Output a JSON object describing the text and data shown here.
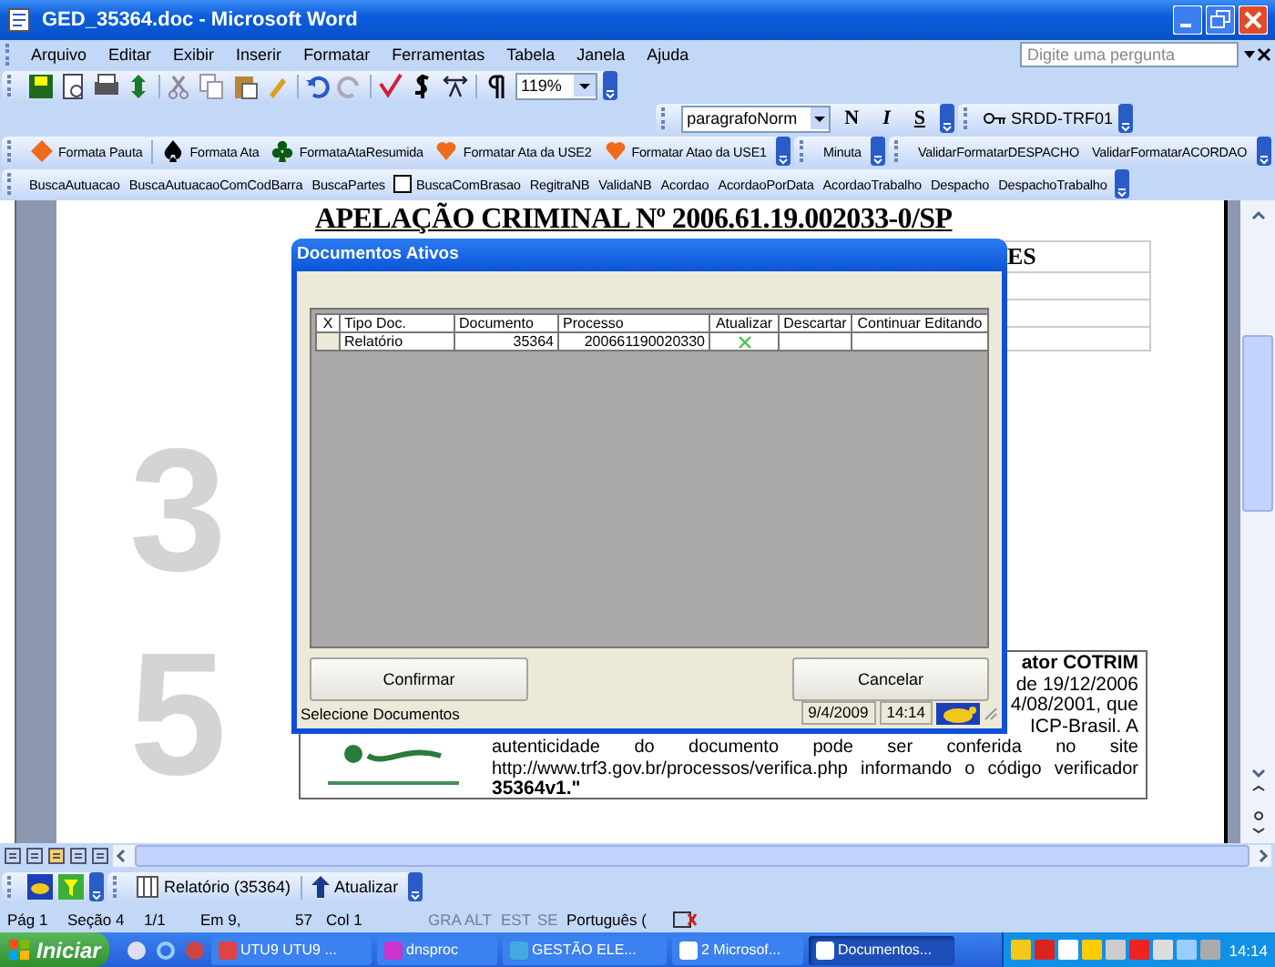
{
  "window": {
    "title": "GED_35364.doc - Microsoft Word"
  },
  "menu": [
    "Arquivo",
    "Editar",
    "Exibir",
    "Inserir",
    "Formatar",
    "Ferramentas",
    "Tabela",
    "Janela",
    "Ajuda"
  ],
  "help_box": {
    "placeholder": "Digite uma pergunta"
  },
  "standard_toolbar": {
    "zoom": "119%"
  },
  "format_toolbar": {
    "style": "paragrafoNorm",
    "buttons": [
      "N",
      "I",
      "S"
    ]
  },
  "srdd_toolbar": {
    "label": "SRDD-TRF01"
  },
  "macro_toolbar": {
    "groups": [
      [
        "Formata Pauta",
        "Formata Ata",
        "FormataAtaResumida",
        "Formatar Ata da USE2",
        "Formatar Atao da USE1"
      ],
      [
        "Minuta"
      ],
      [
        "ValidarFormatarDESPACHO",
        "ValidarFormatarACORDAO"
      ]
    ]
  },
  "search_toolbar": [
    {
      "label": "BuscaAutuacao",
      "checkbox": false
    },
    {
      "label": "BuscaAutuacaoComCodBarra",
      "checkbox": false
    },
    {
      "label": "BuscaPartes",
      "checkbox": false
    },
    {
      "label": "BuscaComBrasao",
      "checkbox": true
    },
    {
      "label": "RegitraNB",
      "checkbox": false
    },
    {
      "label": "ValidaNB",
      "checkbox": false
    },
    {
      "label": "Acordao",
      "checkbox": false
    },
    {
      "label": "AcordaoPorData",
      "checkbox": false
    },
    {
      "label": "AcordaoTrabalho",
      "checkbox": false
    },
    {
      "label": "Despacho",
      "checkbox": false
    },
    {
      "label": "DespachoTrabalho",
      "checkbox": false
    }
  ],
  "document": {
    "watermark": [
      "3",
      "5"
    ],
    "heading": "APELAÇÃO CRIMINAL Nº 2006.61.19.002033-0/SP",
    "table_text": "ES",
    "signature_lines": [
      "ator COTRIM",
      "de 19/12/2006",
      "4/08/2001, que",
      "ICP-Brasil. A"
    ],
    "signature_text": [
      "autenticidade do documento pode ser conferida no site",
      "http://www.trf3.gov.br/processos/verifica.php informando o código verificador"
    ],
    "code": "35364v1.\""
  },
  "dialog": {
    "title": "Documentos Ativos",
    "columns": [
      "X",
      "Tipo Doc.",
      "Documento",
      "Processo",
      "Atualizar",
      "Descartar",
      "Continuar Editando"
    ],
    "rows": [
      {
        "tipo": "Relatório",
        "documento": "35364",
        "processo": "200661190020330",
        "atualizar": true,
        "descartar": false
      }
    ],
    "buttons": [
      "Confirmar",
      "Cancelar"
    ],
    "status": {
      "message": "Selecione Documentos",
      "date": "9/4/2009",
      "time": "14:14"
    }
  },
  "bottom_toolbar": {
    "document": "Relatório  (35364)",
    "update": "Atualizar"
  },
  "status_bar": [
    {
      "text": "Pág 1",
      "disabled": false
    },
    {
      "text": "Seção 4",
      "disabled": false
    },
    {
      "text": "1/1",
      "disabled": false
    },
    {
      "text": "Em 9,",
      "disabled": false
    },
    {
      "text": "57",
      "disabled": false
    },
    {
      "text": "Col 1",
      "disabled": false
    },
    {
      "text": "GRA",
      "disabled": true
    },
    {
      "text": "ALT",
      "disabled": true
    },
    {
      "text": "EST",
      "disabled": true
    },
    {
      "text": "SE",
      "disabled": true
    },
    {
      "text": "Português (",
      "disabled": false
    }
  ],
  "taskbar": {
    "start": "Iniciar",
    "tasks": [
      {
        "label": "UTU9 UTU9 ...",
        "selected": false
      },
      {
        "label": "dnsproc",
        "selected": false
      },
      {
        "label": "GESTÃO ELE...",
        "selected": false
      },
      {
        "label": "2 Microsof...",
        "selected": false
      },
      {
        "label": "Documentos...",
        "selected": true
      }
    ],
    "clock": "14:14"
  }
}
